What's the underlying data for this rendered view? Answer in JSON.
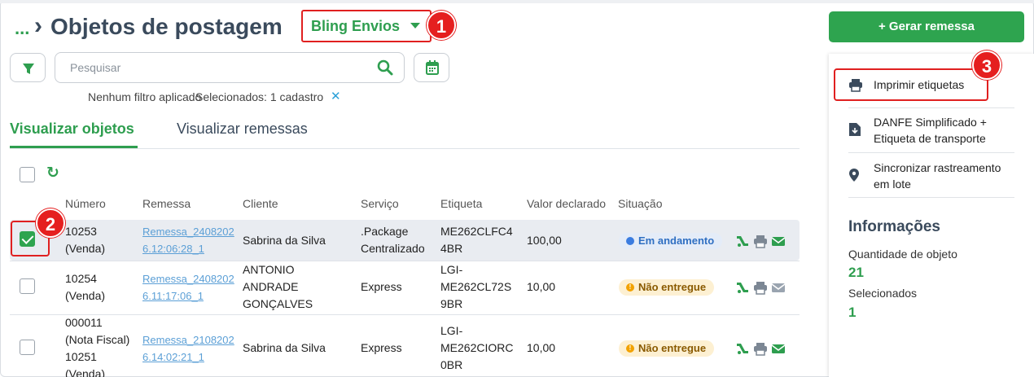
{
  "header": {
    "ellipsis": "...",
    "title": "Objetos de postagem",
    "account": "Bling Envios",
    "gerar_button": "+ Gerar remessa"
  },
  "badges": [
    "1",
    "2",
    "3"
  ],
  "search": {
    "placeholder": "Pesquisar"
  },
  "filters": {
    "no_filter": "Nenhum filtro aplicado",
    "selected": "Selecionados: 1 cadastro",
    "clear": "✕"
  },
  "tabs": [
    {
      "label": "Visualizar objetos",
      "active": true
    },
    {
      "label": "Visualizar remessas",
      "active": false
    }
  ],
  "table": {
    "columns": [
      "Número",
      "Remessa",
      "Cliente",
      "Serviço",
      "Etiqueta",
      "Valor declarado",
      "Situação"
    ],
    "rows": [
      {
        "checked": true,
        "numero": [
          "10253",
          "(Venda)"
        ],
        "remessa": [
          "Remessa_2408202",
          "6.12:06:28_1"
        ],
        "cliente": [
          "Sabrina da Silva"
        ],
        "servico": [
          ".Package",
          "Centralizado"
        ],
        "etiqueta": [
          "ME262CLFC4",
          "4BR"
        ],
        "valor": "100,00",
        "situacao": "Em andamento",
        "status_kind": "running"
      },
      {
        "checked": false,
        "numero": [
          "10254",
          "(Venda)"
        ],
        "remessa": [
          "Remessa_2408202",
          "6.11:17:06_1"
        ],
        "cliente": [
          "ANTONIO",
          "ANDRADE",
          "GONÇALVES"
        ],
        "servico": [
          "Express"
        ],
        "etiqueta": [
          "LGI-",
          "ME262CL72S",
          "9BR"
        ],
        "valor": "10,00",
        "situacao": "Não entregue",
        "status_kind": "warning"
      },
      {
        "checked": false,
        "numero": [
          "000011",
          "(Nota Fiscal)",
          "10251",
          "(Venda)"
        ],
        "remessa": [
          "Remessa_2108202",
          "6.14:02:21_1"
        ],
        "cliente": [
          "Sabrina da Silva"
        ],
        "servico": [
          "Express"
        ],
        "etiqueta": [
          "LGI-",
          "ME262CIORC",
          "0BR"
        ],
        "valor": "10,00",
        "situacao": "Não entregue",
        "status_kind": "warning"
      }
    ]
  },
  "actions": [
    {
      "label": "Imprimir etiquetas",
      "icon": "printer-icon"
    },
    {
      "label": [
        "DANFE Simplificado +",
        "Etiqueta de transporte"
      ],
      "icon": "file-download-icon"
    },
    {
      "label": [
        "Sincronizar rastreamento",
        "em lote"
      ],
      "icon": "map-pin-icon"
    }
  ],
  "info": {
    "title": "Informações",
    "quantity_label": "Quantidade de objeto",
    "quantity_value": "21",
    "selected_label": "Selecionados",
    "selected_value": "1"
  },
  "colors": {
    "brand_green": "#2e9e4f",
    "annotation_red": "#e51f1f",
    "link_blue": "#5b9fd6"
  }
}
